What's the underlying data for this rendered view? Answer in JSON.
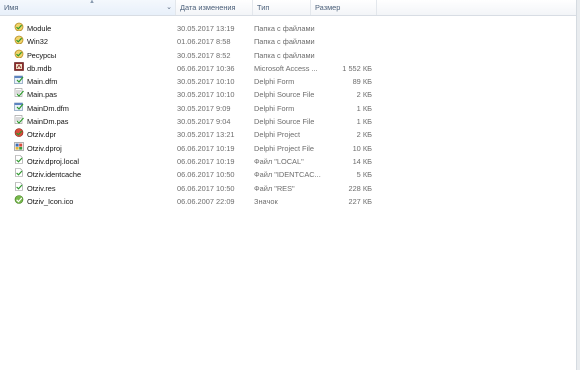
{
  "columns": {
    "name": "Имя",
    "date": "Дата изменения",
    "type": "Тип",
    "size": "Размер"
  },
  "files": [
    {
      "name": "Module",
      "date": "30.05.2017 13:19",
      "type": "Папка с файлами",
      "size": "",
      "icon": "folder-icon"
    },
    {
      "name": "Win32",
      "date": "01.06.2017 8:58",
      "type": "Папка с файлами",
      "size": "",
      "icon": "folder-icon"
    },
    {
      "name": "Ресурсы",
      "date": "30.05.2017 8:52",
      "type": "Папка с файлами",
      "size": "",
      "icon": "folder-icon"
    },
    {
      "name": "db.mdb",
      "date": "06.06.2017 10:36",
      "type": "Microsoft Access ...",
      "size": "1 552 КБ",
      "icon": "access-db-icon"
    },
    {
      "name": "Main.dfm",
      "date": "30.05.2017 10:10",
      "type": "Delphi Form",
      "size": "89 КБ",
      "icon": "delphi-form-icon"
    },
    {
      "name": "Main.pas",
      "date": "30.05.2017 10:10",
      "type": "Delphi Source File",
      "size": "2 КБ",
      "icon": "delphi-source-icon"
    },
    {
      "name": "MainDm.dfm",
      "date": "30.05.2017 9:09",
      "type": "Delphi Form",
      "size": "1 КБ",
      "icon": "delphi-form-icon"
    },
    {
      "name": "MainDm.pas",
      "date": "30.05.2017 9:04",
      "type": "Delphi Source File",
      "size": "1 КБ",
      "icon": "delphi-source-icon"
    },
    {
      "name": "Otziv.dpr",
      "date": "30.05.2017 13:21",
      "type": "Delphi Project",
      "size": "2 КБ",
      "icon": "delphi-project-icon"
    },
    {
      "name": "Otziv.dproj",
      "date": "06.06.2017 10:19",
      "type": "Delphi Project File",
      "size": "10 КБ",
      "icon": "delphi-project-file-icon"
    },
    {
      "name": "Otziv.dproj.local",
      "date": "06.06.2017 10:19",
      "type": "Файл \"LOCAL\"",
      "size": "14 КБ",
      "icon": "generic-file-icon"
    },
    {
      "name": "Otziv.identcache",
      "date": "06.06.2017 10:50",
      "type": "Файл \"IDENTCAC...",
      "size": "5 КБ",
      "icon": "generic-file-icon"
    },
    {
      "name": "Otziv.res",
      "date": "06.06.2017 10:50",
      "type": "Файл \"RES\"",
      "size": "228 КБ",
      "icon": "generic-file-icon"
    },
    {
      "name": "Otziv_Icon.ico",
      "date": "06.06.2007 22:09",
      "type": "Значок",
      "size": "227 КБ",
      "icon": "image-icon"
    }
  ]
}
